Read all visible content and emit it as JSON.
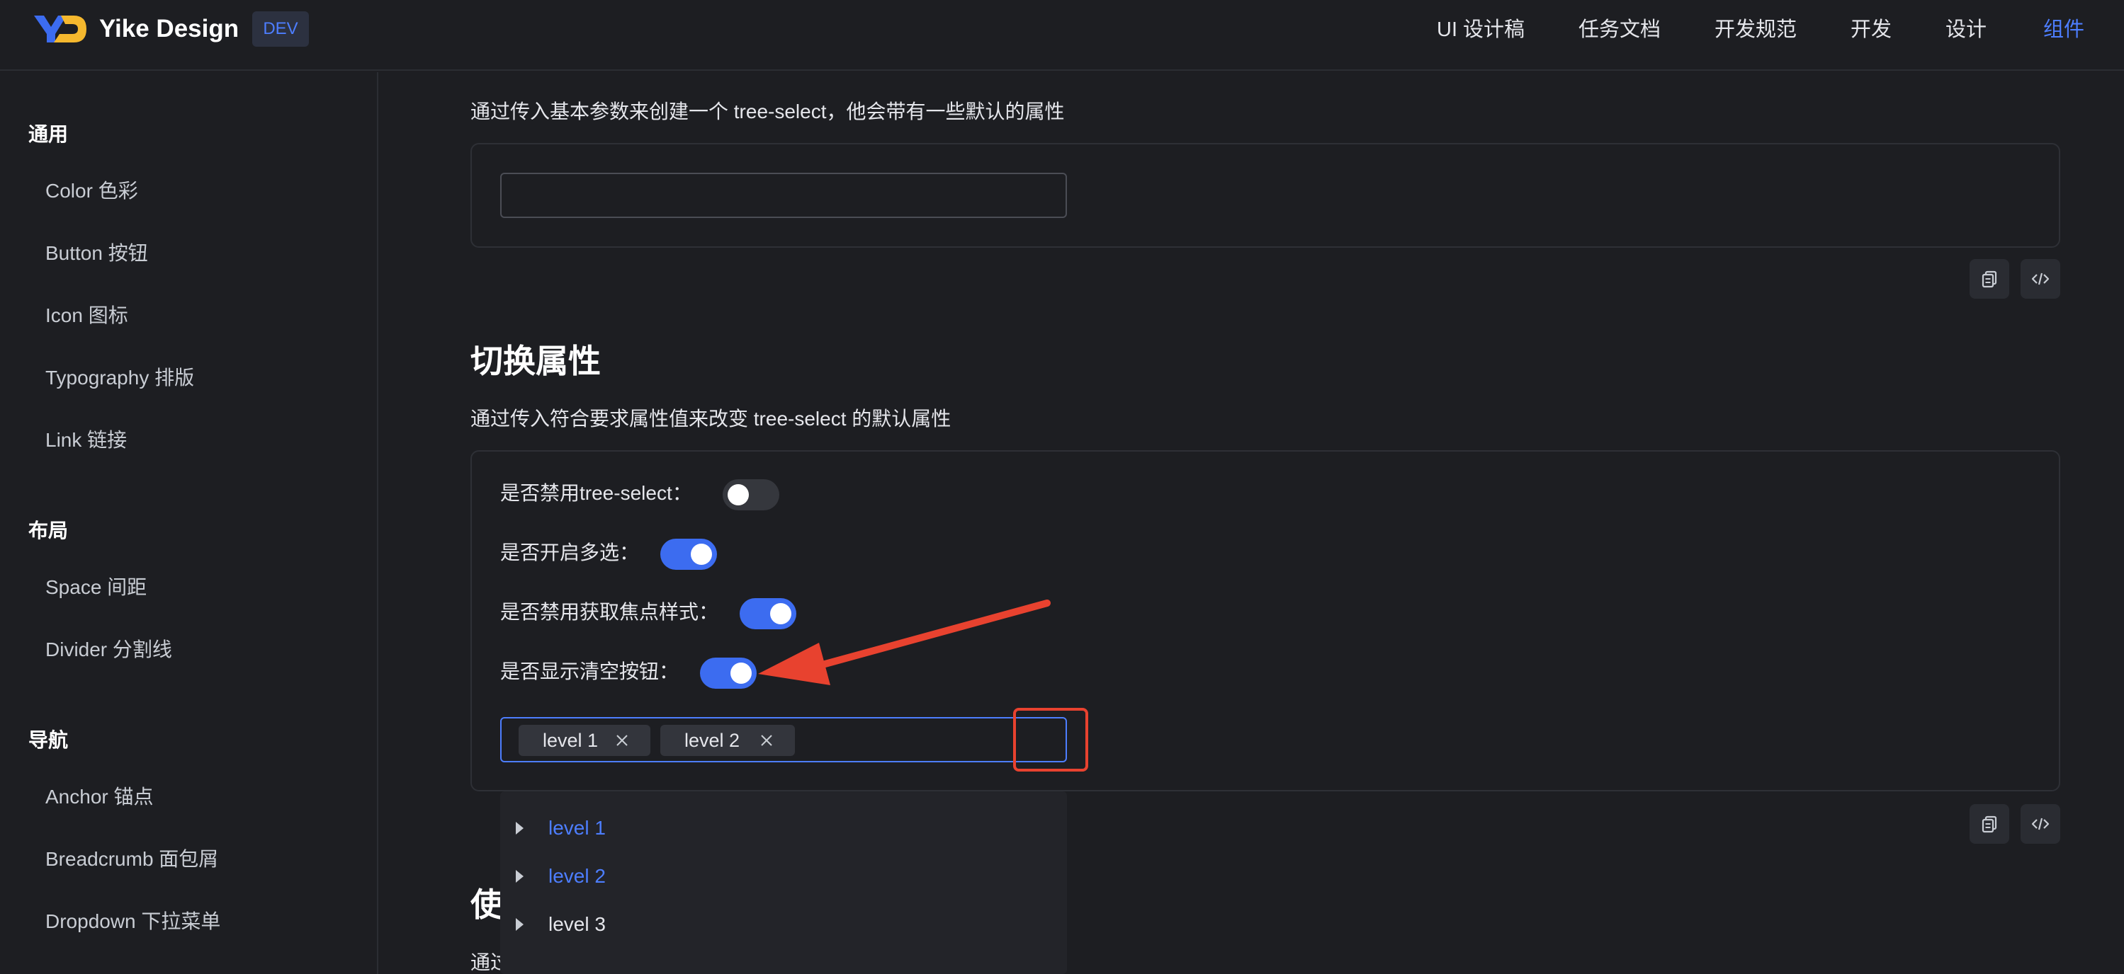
{
  "header": {
    "brand": "Yike Design",
    "badge": "DEV",
    "nav": [
      {
        "label": "UI 设计稿",
        "active": false
      },
      {
        "label": "任务文档",
        "active": false
      },
      {
        "label": "开发规范",
        "active": false
      },
      {
        "label": "开发",
        "active": false
      },
      {
        "label": "设计",
        "active": false
      },
      {
        "label": "组件",
        "active": true
      }
    ]
  },
  "sidebar": {
    "groups": [
      {
        "title": "通用",
        "items": [
          "Color 色彩",
          "Button 按钮",
          "Icon 图标",
          "Typography 排版",
          "Link 链接"
        ]
      },
      {
        "title": "布局",
        "items": [
          "Space 间距",
          "Divider 分割线"
        ]
      },
      {
        "title": "导航",
        "items": [
          "Anchor 锚点",
          "Breadcrumb 面包屑",
          "Dropdown 下拉菜单"
        ]
      }
    ]
  },
  "main": {
    "basic_desc": "通过传入基本参数来创建一个 tree-select，他会带有一些默认的属性",
    "toggle_section": {
      "title": "切换属性",
      "desc": "通过传入符合要求属性值来改变 tree-select 的默认属性",
      "switches": [
        {
          "label": "是否禁用tree-select：",
          "on": false
        },
        {
          "label": "是否开启多选：",
          "on": true
        },
        {
          "label": "是否禁用获取焦点样式：",
          "on": true
        },
        {
          "label": "是否显示清空按钮：",
          "on": true
        }
      ],
      "tags": [
        "level 1",
        "level 2"
      ],
      "dropdown": [
        {
          "label": "level 1",
          "selected": true
        },
        {
          "label": "level 2",
          "selected": true
        },
        {
          "label": "level 3",
          "selected": false
        }
      ]
    },
    "next_section": {
      "title_partial": "使",
      "desc_partial": "通过"
    }
  },
  "colors": {
    "background": "#1d1e22",
    "accent": "#4d7eff",
    "switch_on": "#3c6cf0",
    "annotation_red": "#e8422f"
  },
  "icons": {
    "copy": "copy-icon",
    "code": "code-icon",
    "close": "close-icon",
    "caret": "caret-right-icon"
  }
}
